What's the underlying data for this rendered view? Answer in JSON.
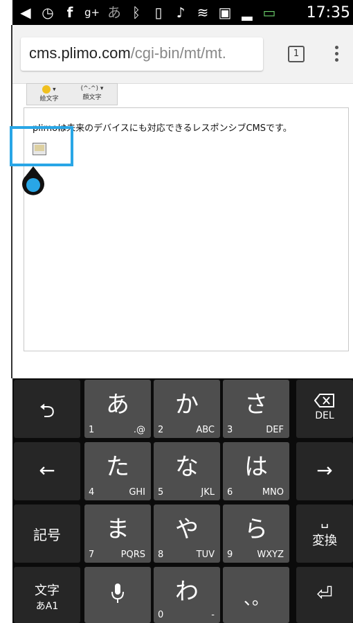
{
  "status_bar": {
    "time": "17:35",
    "icons": [
      "notification-icon",
      "clock-icon",
      "facebook-icon",
      "google-plus-icon",
      "japanese-input-icon",
      "bluetooth-icon",
      "nfc-icon",
      "mute-icon",
      "wifi-icon",
      "screen-icon",
      "signal-icon",
      "battery-icon"
    ]
  },
  "browser": {
    "url_host": "cms.plimo.com",
    "url_path": "/cgi-bin/mt/mt.",
    "tab_count": "1"
  },
  "editor": {
    "toolbar": [
      "絵文字",
      "顔文字"
    ],
    "text": "plimoは未来のデバイスにも対応できるレスポンシブCMSです。"
  },
  "keyboard": {
    "left_keys": {
      "undo": "⮌",
      "left": "←",
      "symbols": "記号",
      "mode_main": "文字",
      "mode_sub": "あA1"
    },
    "right_keys": {
      "delete_label": "DEL",
      "convert_label": "変換"
    },
    "rows": [
      [
        {
          "kana": "あ",
          "num": "1",
          "sub": ".@"
        },
        {
          "kana": "か",
          "num": "2",
          "sub": "ABC"
        },
        {
          "kana": "さ",
          "num": "3",
          "sub": "DEF"
        }
      ],
      [
        {
          "kana": "た",
          "num": "4",
          "sub": "GHI"
        },
        {
          "kana": "な",
          "num": "5",
          "sub": "JKL"
        },
        {
          "kana": "は",
          "num": "6",
          "sub": "MNO"
        }
      ],
      [
        {
          "kana": "ま",
          "num": "7",
          "sub": "PQRS"
        },
        {
          "kana": "や",
          "num": "8",
          "sub": "TUV"
        },
        {
          "kana": "ら",
          "num": "9",
          "sub": "WXYZ"
        }
      ],
      [
        {
          "kana": "",
          "num": "",
          "sub": ""
        },
        {
          "kana": "わ",
          "num": "0",
          "sub": "-"
        },
        {
          "kana": "、。",
          "num": "",
          "sub": ""
        }
      ]
    ]
  }
}
